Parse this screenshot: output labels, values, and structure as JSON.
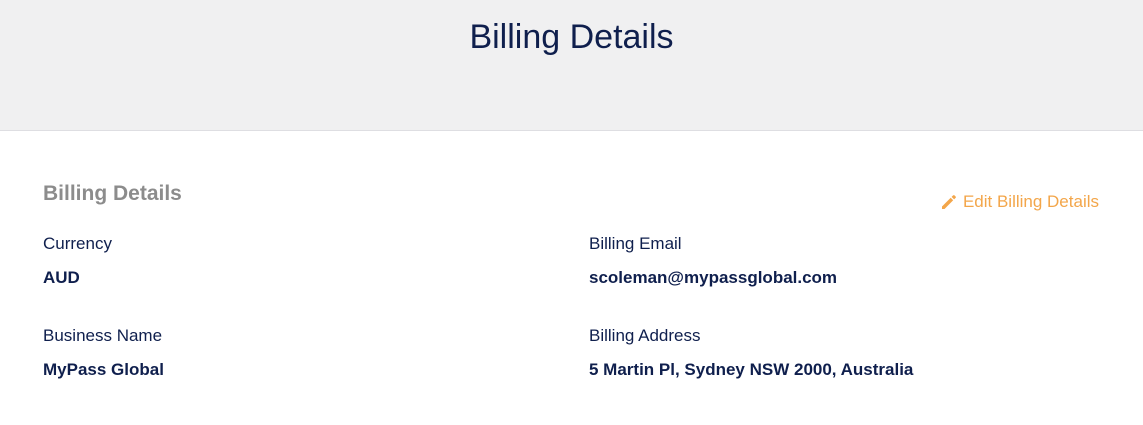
{
  "header": {
    "title": "Billing Details"
  },
  "section": {
    "title": "Billing Details",
    "edit_link": {
      "label": "Edit Billing Details",
      "icon": "pencil-icon",
      "color": "#f3a64a"
    }
  },
  "fields": {
    "currency": {
      "label": "Currency",
      "value": "AUD"
    },
    "billing_email": {
      "label": "Billing Email",
      "value": "scoleman@mypassglobal.com"
    },
    "business_name": {
      "label": "Business Name",
      "value": "MyPass Global"
    },
    "billing_address": {
      "label": "Billing Address",
      "value": "5 Martin Pl, Sydney NSW 2000, Australia"
    }
  },
  "colors": {
    "header_bg": "#f0f0f1",
    "text_primary": "#0f1f4d",
    "section_title": "#8c8c8c",
    "accent": "#f3a64a"
  }
}
